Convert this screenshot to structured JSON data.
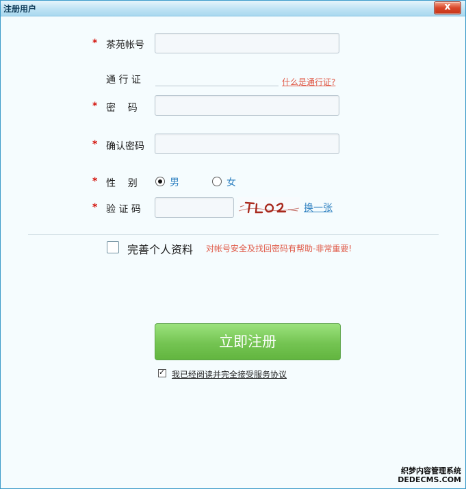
{
  "window": {
    "title": "注册用户",
    "close_label": "x"
  },
  "form": {
    "required_mark": "*",
    "account_label": "茶苑帐号",
    "passport_label": "通 行 证",
    "passport_help_link": "什么是通行证?",
    "password_label": "密    码",
    "confirm_password_label": "确认密码",
    "gender_label": "性    别",
    "gender_male": "男",
    "gender_female": "女",
    "gender_selected": "男",
    "captcha_label": "验 证 码",
    "captcha_refresh_link": "换一张",
    "complete_profile_label": "完善个人资料",
    "complete_profile_hint": "对帐号安全及找回密码有帮助-非常重要!",
    "register_button": "立即注册",
    "agreement_checked": true,
    "agreement_link": "我已经阅读并完全接受服务协议"
  },
  "watermark": {
    "line1": "织梦内容管理系统",
    "line2": "DEDECMS.COM"
  },
  "colors": {
    "required": "#d4150e",
    "link_red": "#e05a48",
    "link_blue": "#2c7fc0",
    "button_green": "#74c452"
  }
}
